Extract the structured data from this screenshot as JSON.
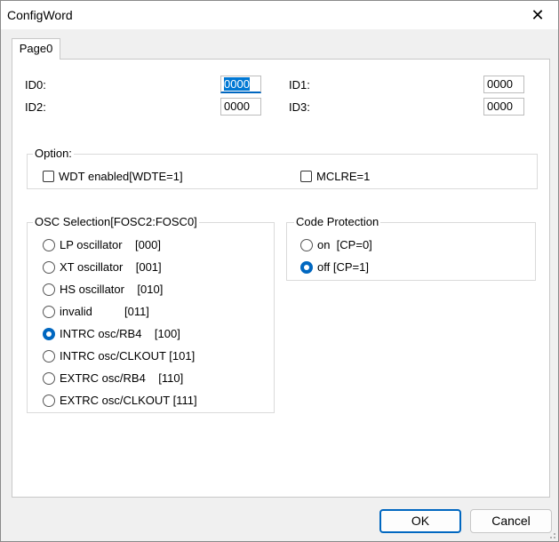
{
  "window": {
    "title": "ConfigWord",
    "close_glyph": "✕"
  },
  "tabs": [
    {
      "label": "Page0"
    }
  ],
  "ids": {
    "id0": {
      "label": "ID0:",
      "value": "0000"
    },
    "id1": {
      "label": "ID1:",
      "value": "0000"
    },
    "id2": {
      "label": "ID2:",
      "value": "0000"
    },
    "id3": {
      "label": "ID3:",
      "value": "0000"
    }
  },
  "option": {
    "title": "Option:",
    "wdte": {
      "label": "WDT enabled[WDTE=1]",
      "checked": false
    },
    "mclre": {
      "label": "MCLRE=1",
      "checked": false
    }
  },
  "osc": {
    "title": "OSC Selection[FOSC2:FOSC0]",
    "items": [
      {
        "label": "LP oscillator    [000]",
        "selected": false
      },
      {
        "label": "XT oscillator    [001]",
        "selected": false
      },
      {
        "label": "HS oscillator    [010]",
        "selected": false
      },
      {
        "label": "invalid          [011]",
        "selected": false
      },
      {
        "label": "INTRC osc/RB4    [100]",
        "selected": true
      },
      {
        "label": "INTRC osc/CLKOUT [101]",
        "selected": false
      },
      {
        "label": "EXTRC osc/RB4    [110]",
        "selected": false
      },
      {
        "label": "EXTRC osc/CLKOUT [111]",
        "selected": false
      }
    ]
  },
  "code_protection": {
    "title": "Code Protection",
    "items": [
      {
        "label": "on  [CP=0]",
        "selected": false
      },
      {
        "label": "off [CP=1]",
        "selected": true
      }
    ]
  },
  "buttons": {
    "ok": "OK",
    "cancel": "Cancel"
  },
  "colors": {
    "accent": "#0067c0",
    "selection": "#0078d4"
  }
}
